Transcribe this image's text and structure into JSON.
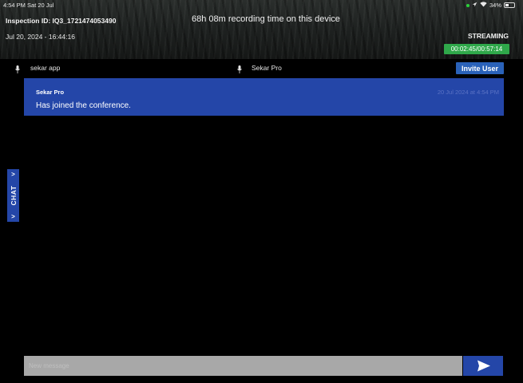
{
  "status_bar": {
    "time": "4:54 PM  Sat 20 Jul",
    "battery": "34%"
  },
  "header": {
    "inspection_id": "Inspection ID: IQ3_1721474053490",
    "recording_time": "68h 08m recording time on this device",
    "date": "Jul 20, 2024 - 16:44:16",
    "streaming_label": "STREAMING",
    "timer": "00:02:45/00:57:14"
  },
  "participants": [
    {
      "name": "sekar app",
      "icon": "microphone-icon"
    },
    {
      "name": "Sekar Pro",
      "icon": "microphone-icon"
    }
  ],
  "invite_button": "Invite User",
  "messages": [
    {
      "sender": "Sekar Pro",
      "timestamp": "20 Jul 2024 at 4:54 PM",
      "text": "Has joined the conference."
    }
  ],
  "chat_tab": {
    "label": "CHAT",
    "chevron": ">"
  },
  "composer": {
    "placeholder": "New message",
    "send_icon": "send-icon"
  },
  "colors": {
    "accent_blue": "#2446a8",
    "invite_blue": "#2a62b9",
    "timer_green": "#2fa84a",
    "input_gray": "#a8a8a8"
  }
}
